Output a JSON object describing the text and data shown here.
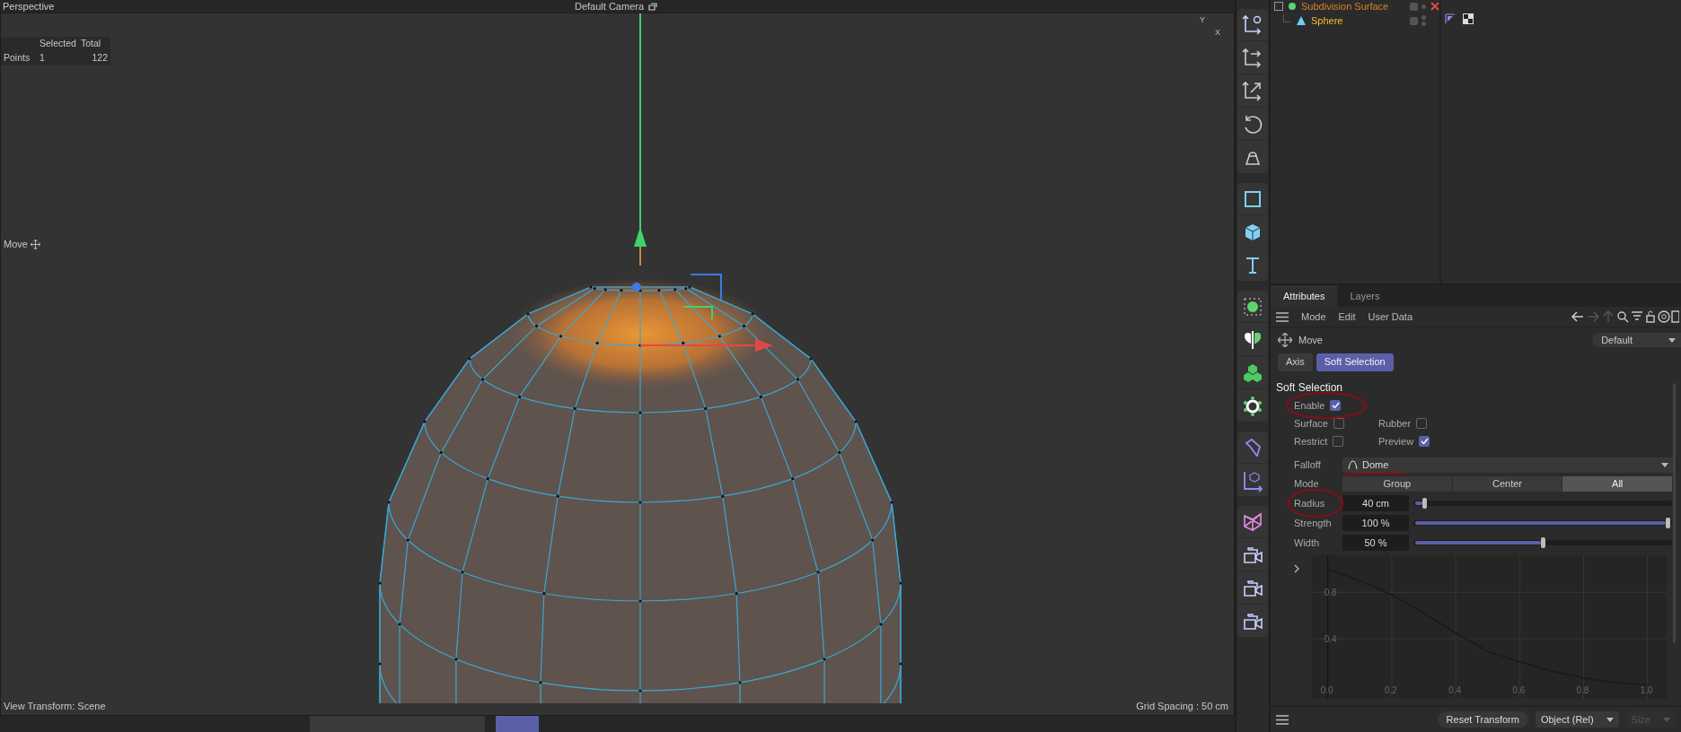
{
  "viewport": {
    "title": "Perspective",
    "camera": "Default Camera",
    "tool": "Move",
    "stats": {
      "headers": [
        "Selected",
        "Total"
      ],
      "rows": [
        {
          "label": "Points",
          "selected_count": "1",
          "total": "122"
        }
      ]
    },
    "axis_labels": [
      "Y",
      "X"
    ],
    "view_transform": "View Transform: Scene",
    "grid_spacing": "Grid Spacing : 50 cm"
  },
  "objects": [
    {
      "name": "Subdivision Surface",
      "kind": "generator",
      "children": [
        {
          "name": "Sphere",
          "kind": "polygon"
        }
      ]
    }
  ],
  "attributes": {
    "tabs": [
      {
        "label": "Attributes",
        "selected": true
      },
      {
        "label": "Layers",
        "selected": false
      }
    ],
    "menu": [
      "Mode",
      "Edit",
      "User Data"
    ],
    "tool": "Move",
    "preset": "Default",
    "subtabs": [
      {
        "label": "Axis",
        "selected": false
      },
      {
        "label": "Soft Selection",
        "selected": true
      }
    ],
    "section": "Soft Selection",
    "check_rows": [
      [
        {
          "label": "Enable",
          "checked": true
        }
      ],
      [
        {
          "label": "Surface",
          "checked": false
        },
        {
          "label": "Rubber",
          "checked": false
        }
      ],
      [
        {
          "label": "Restrict",
          "checked": false
        },
        {
          "label": "Preview",
          "checked": true
        }
      ]
    ],
    "falloff": {
      "label": "Falloff",
      "value": "Dome"
    },
    "mode": {
      "label": "Mode",
      "options": [
        {
          "label": "Group",
          "selected": false
        },
        {
          "label": "Center",
          "selected": false
        },
        {
          "label": "All",
          "selected": true
        }
      ]
    },
    "sliders": [
      {
        "label": "Radius",
        "value": "40 cm",
        "level": 0.03
      },
      {
        "label": "Strength",
        "value": "100 %",
        "level": 1.0
      },
      {
        "label": "Width",
        "value": "50 %",
        "level": 0.5
      }
    ],
    "chart_data": {
      "type": "line",
      "x": [
        0,
        0.1,
        0.2,
        0.3,
        0.4,
        0.5,
        0.6,
        0.7,
        0.8,
        0.9,
        1.0
      ],
      "values": [
        1.0,
        0.9,
        0.78,
        0.62,
        0.45,
        0.29,
        0.2,
        0.12,
        0.06,
        0.02,
        0.0
      ],
      "xlim": [
        -0.05,
        1.06
      ],
      "ylim": [
        -0.12,
        1.12
      ],
      "xticks": [
        {
          "value": 0,
          "label": "0.0"
        },
        {
          "value": 0.2,
          "label": "0.2"
        },
        {
          "value": 0.4,
          "label": "0.4"
        },
        {
          "value": 0.6,
          "label": "0.6"
        },
        {
          "value": 0.8,
          "label": "0.8"
        },
        {
          "value": 1,
          "label": "1.0"
        }
      ],
      "yticks": [
        0.4,
        0.8
      ],
      "grid": true
    },
    "footer": {
      "button": "Reset Transform",
      "dropdowns": [
        {
          "label": "Object (Rel)",
          "disabled": false
        },
        {
          "label": "Size",
          "disabled": true
        }
      ]
    }
  }
}
